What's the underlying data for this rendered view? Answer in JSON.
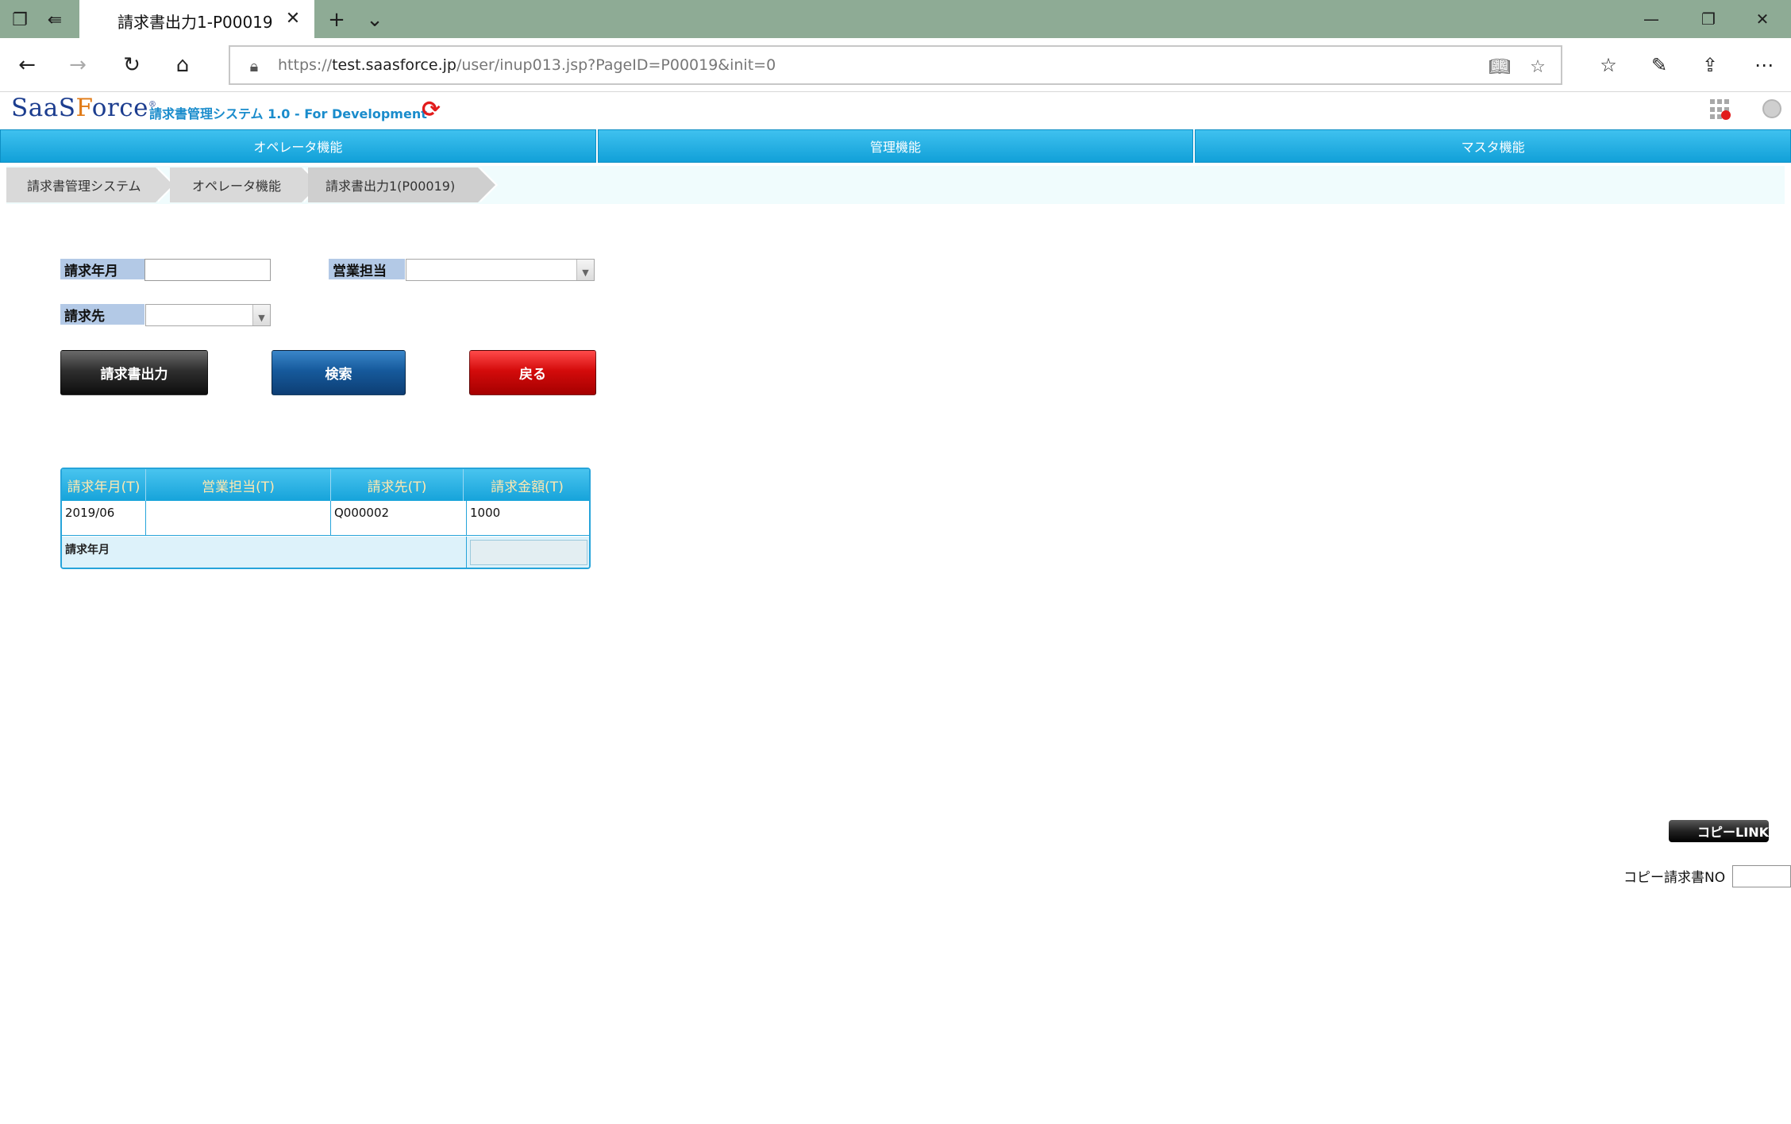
{
  "browser": {
    "tab_title": "請求書出力1-P00019",
    "url_prefix": "https://",
    "url_host": "test.saasforce.jp",
    "url_path": "/user/inup013.jsp?PageID=P00019&init=0"
  },
  "app": {
    "logo_part1": "SaaS",
    "logo_part2": "F",
    "logo_part3": "orce",
    "logo_mark": "®",
    "subtitle": "請求書管理システム 1.0 - For Development"
  },
  "menu": {
    "items": [
      {
        "label": "オペレータ機能"
      },
      {
        "label": "管理機能"
      },
      {
        "label": "マスタ機能"
      }
    ]
  },
  "breadcrumb": {
    "items": [
      {
        "label": "請求書管理システム"
      },
      {
        "label": "オペレータ機能"
      },
      {
        "label": "請求書出力1(P00019)"
      }
    ]
  },
  "form": {
    "billing_month_label": "請求年月",
    "billing_month_value": "",
    "sales_rep_label": "営業担当",
    "sales_rep_value": "",
    "customer_label": "請求先",
    "customer_value": ""
  },
  "buttons": {
    "output": "請求書出力",
    "search": "検索",
    "back": "戻る"
  },
  "grid": {
    "columns": [
      "請求年月(T)",
      "営業担当(T)",
      "請求先(T)",
      "請求金額(T)"
    ],
    "rows": [
      [
        "2019/06",
        "",
        "Q000002",
        "1000"
      ]
    ],
    "footer_label": "請求年月"
  },
  "copy": {
    "button_label": "コピーLINK",
    "no_label": "コピー請求書NO",
    "no_value": ""
  }
}
